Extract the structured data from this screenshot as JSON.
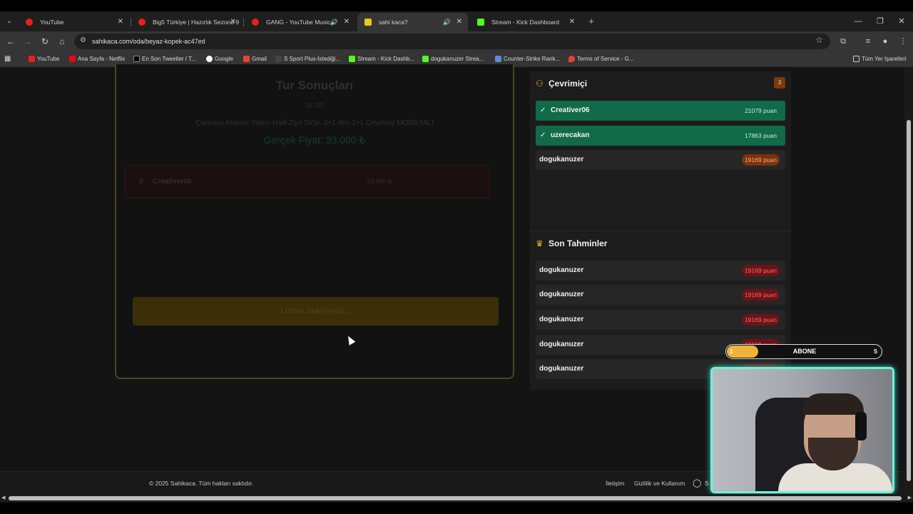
{
  "browser": {
    "tabs": [
      {
        "title": "YouTube",
        "icon": "youtube-icon",
        "color": "#e62117"
      },
      {
        "title": "Big5 Türkiye | Hazırlık Sezonu 9",
        "icon": "youtube-icon",
        "color": "#e62117"
      },
      {
        "title": "GANG - YouTube Music",
        "icon": "youtube-music-icon",
        "color": "#e62117",
        "audio": true
      },
      {
        "title": "sahi kaca?",
        "icon": "question-icon",
        "color": "#e8c91e",
        "audio": true,
        "active": true
      },
      {
        "title": "Stream - Kick Dashboard",
        "icon": "kick-icon",
        "color": "#53fc18"
      }
    ],
    "new_tab": "+",
    "url": "sahikaca.com/oda/beyaz-kopek-ac47ed",
    "bookmarks": [
      {
        "label": "YouTube",
        "color": "#e62117"
      },
      {
        "label": "Ana Sayfa - Netflix",
        "color": "#e50914"
      },
      {
        "label": "En Son Tweetler / T...",
        "color": "#ffffff"
      },
      {
        "label": "Google",
        "color": "#4285f4"
      },
      {
        "label": "Gmail",
        "color": "#ea4335"
      },
      {
        "label": "S Sport Plus-İstediği...",
        "color": "#222222"
      },
      {
        "label": "Stream - Kick Dashb...",
        "color": "#53fc18"
      },
      {
        "label": "dogukanuzer Strea...",
        "color": "#53fc18"
      },
      {
        "label": "Counter-Strike Rank...",
        "color": "#5b8bd6"
      },
      {
        "label": "Terms of Service - G...",
        "color": "#ea4335"
      }
    ],
    "all_bookmarks": "Tüm Yer İşaretleri"
  },
  "game": {
    "title": "Tur Sonuçları",
    "progress": "20 / 20",
    "product": "Çankaya Atakule Yakını Halil Ziya Sk'ta, 3+1 den 2+1 Çevrilmiş MOBİLYALI",
    "price": "Gerçek Fiyat: 33.000 ₺",
    "guess": {
      "name": "Creativer06",
      "value": "33.000 ₺"
    },
    "placeholder": "",
    "wait_button": "Lütfen bekleyiniz..."
  },
  "online": {
    "title": "Çevrimiçi",
    "count": "3",
    "players": [
      {
        "name": "Creativer06",
        "points": "21079 puan",
        "correct": true
      },
      {
        "name": "uzerecakan",
        "points": "17863 puan",
        "correct": true
      },
      {
        "name": "dogukanuzer",
        "points": "19169 puan",
        "correct": false
      }
    ]
  },
  "recent": {
    "title": "Son Tahminler",
    "guesses": [
      {
        "name": "dogukanuzer",
        "points": "19169 puan"
      },
      {
        "name": "dogukanuzer",
        "points": "19169 puan"
      },
      {
        "name": "dogukanuzer",
        "points": "19169 puan"
      },
      {
        "name": "dogukanuzer",
        "points": "19169 puan"
      },
      {
        "name": "dogukanuzer",
        "points": "19169 puan"
      }
    ]
  },
  "footer": {
    "copyright": "© 2025 Sahikaca. Tüm hakları saklıdır.",
    "contact": "İletişim",
    "privacy": "Gizlilik ve Kullanım",
    "truncated": "S"
  },
  "overlay": {
    "abone_current": "1",
    "abone_label": "ABONE",
    "abone_goal": "5",
    "abone_progress": 0.2
  }
}
